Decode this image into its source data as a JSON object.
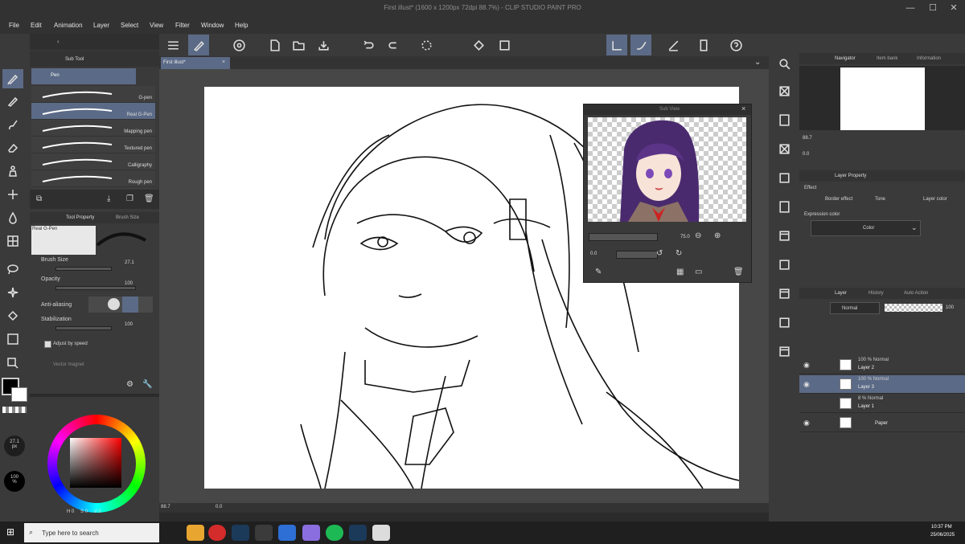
{
  "window": {
    "title": "First illust* (1600 x 1200px 72dpi 88.7%) - CLIP STUDIO PAINT PRO"
  },
  "menu": [
    "File",
    "Edit",
    "Animation",
    "Layer",
    "Select",
    "View",
    "Filter",
    "Window",
    "Help"
  ],
  "canvas_tab": "First illust*",
  "subtool": {
    "tab": "Sub Tool",
    "group": "Pen",
    "items": [
      "G-pen",
      "Real G-Pen",
      "Mapping pen",
      "Textured pen",
      "Calligraphy",
      "Rough pen"
    ],
    "selected": "Real G-Pen"
  },
  "tool_property": {
    "tab1": "Tool Property",
    "tab2": "Brush Size",
    "preview_name": "Real G-Pen",
    "brush_size_label": "Brush Size",
    "brush_size_value": "27.1",
    "opacity_label": "Opacity",
    "opacity_value": "100",
    "antialias_label": "Anti-aliasing",
    "stabilization_label": "Stabilization",
    "stabilization_value": "100",
    "adjust_label": "Adjust by speed",
    "vector_label": "Vector magnet"
  },
  "brush_indicator": {
    "size": "27.1",
    "unit": "px",
    "opacity": "100",
    "opacity_unit": "%"
  },
  "color_wheel": {
    "h_label": "H",
    "h": "0",
    "s_label": "S",
    "s": "0",
    "v_label": "V",
    "v": "0"
  },
  "bottom_bar": {
    "zoom": "88.7",
    "angle": "0.0"
  },
  "subview": {
    "title": "Sub View",
    "zoom": "75.0",
    "angle": "0.0"
  },
  "navigator": {
    "tab1": "Navigator",
    "tab2": "Item bank",
    "tab3": "Information",
    "zoom": "88.7",
    "angle": "0.0"
  },
  "layer_property": {
    "tab": "Layer Property",
    "effect_label": "Effect",
    "border_effect": "Border effect",
    "tone": "Tone",
    "layer_color": "Layer color",
    "expression_label": "Expression color",
    "expression_value": "Color"
  },
  "layer_panel": {
    "tab1": "Layer",
    "tab2": "History",
    "tab3": "Auto Action",
    "blend_mode": "Normal",
    "opacity": "100",
    "layers": [
      {
        "mode": "100 % Normal",
        "name": "Layer 2"
      },
      {
        "mode": "100 % Normal",
        "name": "Layer 3"
      },
      {
        "mode": "8 % Normal",
        "name": "Layer 1"
      },
      {
        "mode": "",
        "name": "Paper"
      }
    ]
  },
  "taskbar": {
    "search_placeholder": "Type here to search",
    "time": "10:37 PM",
    "date": "25/06/2025"
  },
  "colors": {
    "accent": "#5b6a86",
    "panel": "#3a3a3a",
    "canvas_bg": "#474747"
  }
}
